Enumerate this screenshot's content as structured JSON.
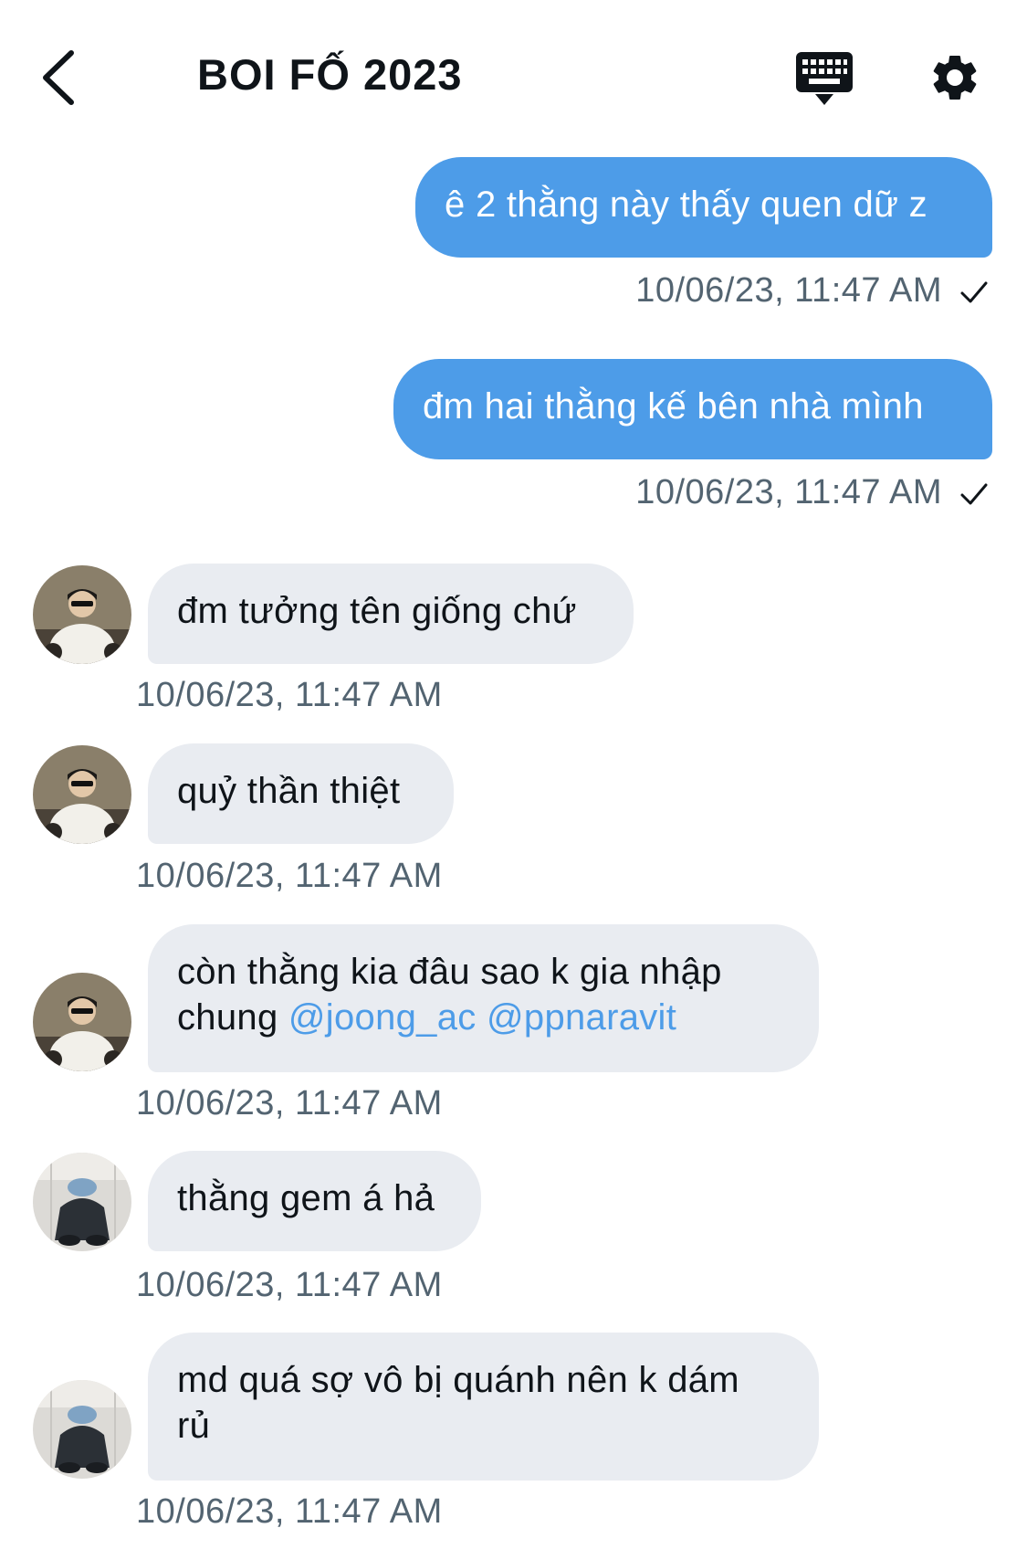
{
  "header": {
    "title": "BOI FỐ 2023",
    "back_icon": "chevron-left-icon",
    "keyboard_icon": "keyboard-icon",
    "settings_icon": "gear-icon"
  },
  "colors": {
    "outgoing_bubble": "#4d9ce8",
    "incoming_bubble": "#e9ecf1",
    "timestamp": "#536471",
    "mention": "#4d9ce8"
  },
  "messages": [
    {
      "direction": "out",
      "text": "ê 2 thằng này thấy quen dữ z",
      "time": "10/06/23, 11:47 AM"
    },
    {
      "direction": "out",
      "text": "đm hai thằng kế bên nhà mình",
      "time": "10/06/23, 11:47 AM"
    },
    {
      "direction": "in",
      "avatar": "avatar-user-a",
      "text": "đm tưởng tên giống chứ",
      "time": "10/06/23, 11:47 AM"
    },
    {
      "direction": "in",
      "avatar": "avatar-user-a",
      "text": "quỷ thần thiệt",
      "time": "10/06/23, 11:47 AM"
    },
    {
      "direction": "in",
      "avatar": "avatar-user-a",
      "text_line1": "còn thằng kia đâu sao k gia nhập",
      "text_line2_prefix": "chung ",
      "mention1": "@joong_ac",
      "mention2": "@ppnaravit",
      "time": "10/06/23, 11:47 AM"
    },
    {
      "direction": "in",
      "avatar": "avatar-user-b",
      "text": "thằng gem á hả",
      "time": "10/06/23, 11:47 AM"
    },
    {
      "direction": "in",
      "avatar": "avatar-user-b",
      "text_line1": "md quá sợ vô bị quánh nên k dám",
      "text_line2": "rủ",
      "time": "10/06/23, 11:47 AM"
    }
  ]
}
